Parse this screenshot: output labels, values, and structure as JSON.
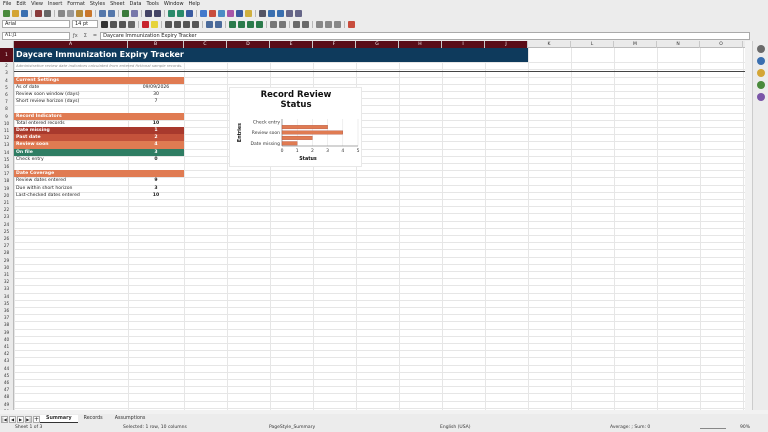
{
  "menu": [
    "File",
    "Edit",
    "View",
    "Insert",
    "Format",
    "Styles",
    "Sheet",
    "Data",
    "Tools",
    "Window",
    "Help"
  ],
  "formatting": {
    "font_name": "Arial",
    "font_size": "14 pt"
  },
  "formula_bar": {
    "name_box": "A1:J1",
    "content": "Daycare Immunization Expiry Tracker"
  },
  "columns": [
    "A",
    "B",
    "C",
    "D",
    "E",
    "F",
    "G",
    "H",
    "I",
    "J",
    "K",
    "L",
    "M",
    "N",
    "O",
    "P"
  ],
  "sheet": {
    "title": "Daycare Immunization Expiry Tracker",
    "note": "Administrative review date indicators calculated from entered fictional sample records.",
    "sections": [
      {
        "row": 4,
        "header": "Current Settings",
        "rows": [
          {
            "row": 5,
            "label": "As of date",
            "value": "09/09/2026"
          },
          {
            "row": 6,
            "label": "Review soon window (days)",
            "value": "30"
          },
          {
            "row": 7,
            "label": "Short review horizon (days)",
            "value": "7"
          }
        ]
      },
      {
        "row": 9,
        "header": "Record Indicators",
        "rows": [
          {
            "row": 10,
            "label": "Total entered records",
            "value": "10",
            "bold": true
          },
          {
            "row": 11,
            "label": "Date missing",
            "value": "1",
            "color": "#a8392d"
          },
          {
            "row": 12,
            "label": "Past date",
            "value": "2",
            "color": "#c4523b"
          },
          {
            "row": 13,
            "label": "Review soon",
            "value": "4",
            "color": "#e07b52"
          },
          {
            "row": 14,
            "label": "On file",
            "value": "3",
            "color": "#2f7d63"
          },
          {
            "row": 15,
            "label": "Check entry",
            "value": "0",
            "bold": true
          }
        ]
      },
      {
        "row": 17,
        "header": "Date Coverage",
        "rows": [
          {
            "row": 18,
            "label": "Review dates entered",
            "value": "9",
            "bold": true
          },
          {
            "row": 19,
            "label": "Due within short horizon",
            "value": "3",
            "bold": true
          },
          {
            "row": 20,
            "label": "Last-checked dates entered",
            "value": "10",
            "bold": true
          }
        ]
      }
    ]
  },
  "chart_data": {
    "type": "bar",
    "orientation": "horizontal",
    "title": "Record Review Status",
    "xlabel": "Status",
    "ylabel": "Entries",
    "categories": [
      "Check entry",
      "Review soon",
      "Date missing"
    ],
    "category_labels_all": [
      "Check entry",
      "On file",
      "Review soon",
      "Past date",
      "Date missing"
    ],
    "values": [
      0,
      3,
      4,
      2,
      1
    ],
    "xlim": [
      0,
      5
    ],
    "xticks": [
      "0",
      "1",
      "2",
      "3",
      "4",
      "5"
    ],
    "bar_color": "#e07b52",
    "grid": true
  },
  "tabs": [
    "Summary",
    "Records",
    "Assumptions"
  ],
  "active_tab": "Summary",
  "status": {
    "sheet": "Sheet 1 of 3",
    "selection": "Selected: 1 row, 10 columns",
    "page_style": "PageStyle_Summary",
    "language": "English (USA)",
    "aggregate": "Average: ; Sum: 0",
    "zoom": "90%"
  },
  "colors": {
    "header_bg": "#0e3a5c",
    "section_bg": "#e07b52",
    "accent": "#5a0d18"
  }
}
